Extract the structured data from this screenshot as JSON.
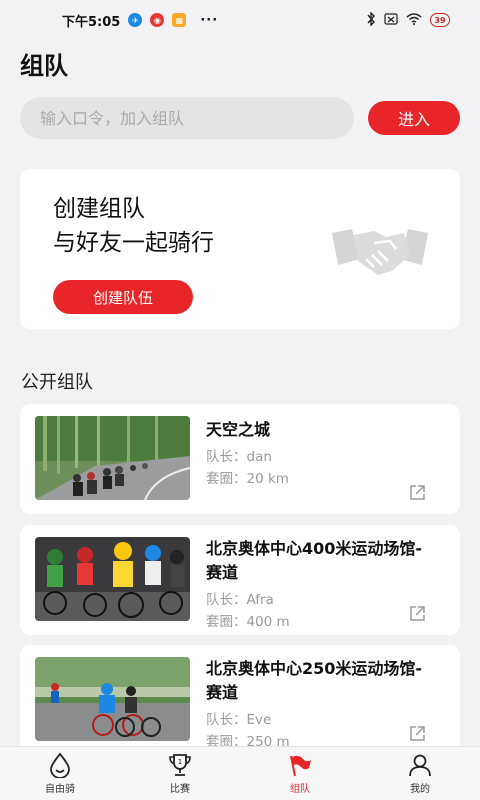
{
  "status_bar": {
    "time": "下午5:05",
    "more": "···",
    "battery": "39"
  },
  "page": {
    "title": "组队"
  },
  "join": {
    "placeholder": "输入口令，加入组队",
    "button": "进入"
  },
  "create_card": {
    "line1": "创建组队",
    "line2": "与好友一起骑行",
    "button": "创建队伍"
  },
  "public_section": {
    "title": "公开组队"
  },
  "teams": [
    {
      "name": "天空之城",
      "captain": "队长：dan",
      "track": "套圈：20 km"
    },
    {
      "name": "北京奥体中心400米运动场馆-赛道",
      "captain": "队长：Afra",
      "track": "套圈：400 m"
    },
    {
      "name": "北京奥体中心250米运动场馆-赛道",
      "captain": "队长：Eve",
      "track": "套圈：250 m"
    }
  ],
  "tabs": [
    {
      "label": "自由骑",
      "icon": "drop-icon",
      "active": false
    },
    {
      "label": "比赛",
      "icon": "trophy-icon",
      "active": false
    },
    {
      "label": "组队",
      "icon": "flag-icon",
      "active": true
    },
    {
      "label": "我的",
      "icon": "user-icon",
      "active": false
    }
  ],
  "colors": {
    "accent": "#e8262a",
    "background": "#f2f2f4",
    "card": "#ffffff",
    "muted_text": "#9a9a9e"
  }
}
